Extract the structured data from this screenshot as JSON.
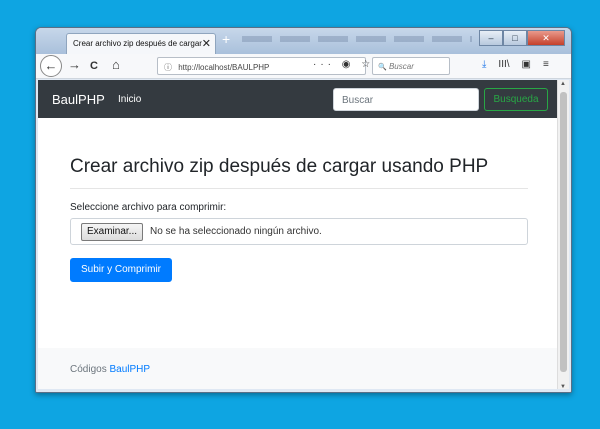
{
  "browser": {
    "tab_title": "Crear archivo zip después de cargar",
    "tab_close": "✕",
    "new_tab": "+",
    "window_controls": {
      "minimize": "–",
      "maximize": "□",
      "close": "✕"
    },
    "nav": {
      "back": "←",
      "forward": "→",
      "reload": "C",
      "home": "⌂"
    },
    "url_info_icon": "ⓘ",
    "url": "http://localhost/BAULPHP",
    "url_actions": "··· ◉ ☆",
    "search_placeholder": "Buscar",
    "search_icon": "🔍",
    "tools": {
      "download": "⤓",
      "library": "III\\",
      "sidebar": "▣",
      "menu": "≡"
    }
  },
  "site": {
    "brand": "BaulPHP",
    "nav_link": "Inicio",
    "search_placeholder": "Buscar",
    "search_button": "Busqueda",
    "title": "Crear archivo zip después de cargar usando PHP",
    "field_label": "Seleccione archivo para comprimir:",
    "file_button": "Examinar...",
    "file_status": "No se ha seleccionado ningún archivo.",
    "submit_label": "Subir y Comprimir",
    "footer_prefix": "Códigos",
    "footer_link": "BaulPHP"
  },
  "colors": {
    "desktop": "#0ea5e2",
    "navbar": "#343a40",
    "primary": "#007bff",
    "success": "#28a745"
  }
}
